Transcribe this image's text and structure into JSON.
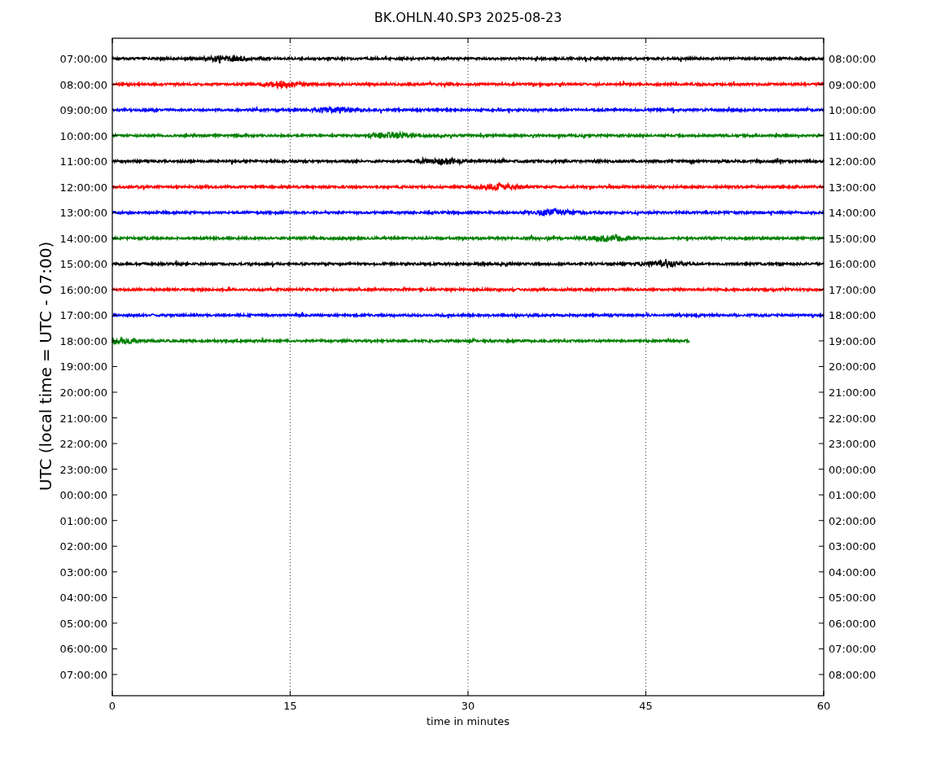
{
  "title": "BK.OHLN.40.SP3 2025-08-23",
  "y_axis_label": "UTC (local time = UTC - 07:00)",
  "x_axis_label": "time in minutes",
  "x_ticks": [
    "0",
    "15",
    "30",
    "45",
    "60"
  ],
  "left_ticks": [
    "07:00:00",
    "08:00:00",
    "09:00:00",
    "10:00:00",
    "11:00:00",
    "12:00:00",
    "13:00:00",
    "14:00:00",
    "15:00:00",
    "16:00:00",
    "17:00:00",
    "18:00:00",
    "19:00:00",
    "20:00:00",
    "21:00:00",
    "22:00:00",
    "23:00:00",
    "00:00:00",
    "01:00:00",
    "02:00:00",
    "03:00:00",
    "04:00:00",
    "05:00:00",
    "06:00:00",
    "07:00:00"
  ],
  "right_ticks": [
    "08:00:00",
    "09:00:00",
    "10:00:00",
    "11:00:00",
    "12:00:00",
    "13:00:00",
    "14:00:00",
    "15:00:00",
    "16:00:00",
    "17:00:00",
    "18:00:00",
    "19:00:00",
    "20:00:00",
    "21:00:00",
    "22:00:00",
    "23:00:00",
    "00:00:00",
    "01:00:00",
    "02:00:00",
    "03:00:00",
    "04:00:00",
    "05:00:00",
    "06:00:00",
    "07:00:00",
    "08:00:00"
  ],
  "traces": [
    {
      "color": "#000000",
      "level": 1
    },
    {
      "color": "#ff0000",
      "level": 1
    },
    {
      "color": "#0000ff",
      "level": 1
    },
    {
      "color": "#008000",
      "level": 1
    },
    {
      "color": "#000000",
      "level": 1
    },
    {
      "color": "#ff0000",
      "level": 1
    },
    {
      "color": "#0000ff",
      "level": 1
    },
    {
      "color": "#008000",
      "level": 1
    },
    {
      "color": "#000000",
      "level": 1
    },
    {
      "color": "#ff0000",
      "level": 1
    },
    {
      "color": "#0000ff",
      "level": 1
    },
    {
      "color": "#008000",
      "level": 0.812
    }
  ]
}
